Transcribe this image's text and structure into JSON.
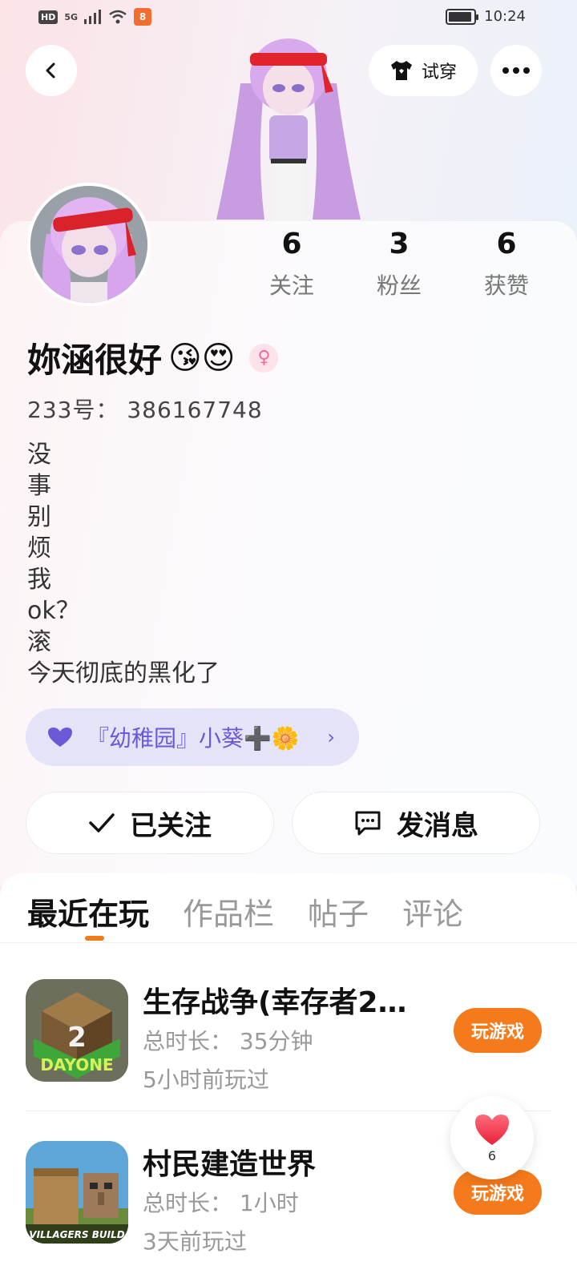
{
  "status_bar": {
    "hd": "HD",
    "network": "5G",
    "app_badge": "8",
    "time": "10:24"
  },
  "header": {
    "try_on_label": "试穿"
  },
  "stats": [
    {
      "value": "6",
      "label": "关注"
    },
    {
      "value": "3",
      "label": "粉丝"
    },
    {
      "value": "6",
      "label": "获赞"
    }
  ],
  "profile": {
    "username": "妳涵很好",
    "emojis": "😘😍",
    "gender_symbol": "♀",
    "uid": "233号： 386167748",
    "bio_lines": [
      "没",
      "事",
      "别",
      "烦",
      "我",
      "ok？",
      "滚",
      "今天彻底的黑化了"
    ]
  },
  "honor": {
    "label": "『幼稚园』小葵➕🌼",
    "color": "#6a5ad8"
  },
  "actions": {
    "follow_label": "已关注",
    "message_label": "发消息"
  },
  "tabs": [
    {
      "label": "最近在玩",
      "active": true
    },
    {
      "label": "作品栏",
      "active": false
    },
    {
      "label": "帖子",
      "active": false
    },
    {
      "label": "评论",
      "active": false
    }
  ],
  "games": [
    {
      "title": "生存战争(幸存者2…",
      "duration": "总时长： 35分钟",
      "last_played": "5小时前玩过",
      "play_label": "玩游戏",
      "icon_text": "DAYONE",
      "icon_num": "2"
    },
    {
      "title": "村民建造世界",
      "duration": "总时长： 1小时",
      "last_played": "3天前玩过",
      "play_label": "玩游戏",
      "icon_text": "VILLAGERS BUILD"
    }
  ],
  "like_float": {
    "count": "6"
  },
  "colors": {
    "accent_orange": "#f47a1b",
    "honor_bg": "#e4e3f7"
  }
}
